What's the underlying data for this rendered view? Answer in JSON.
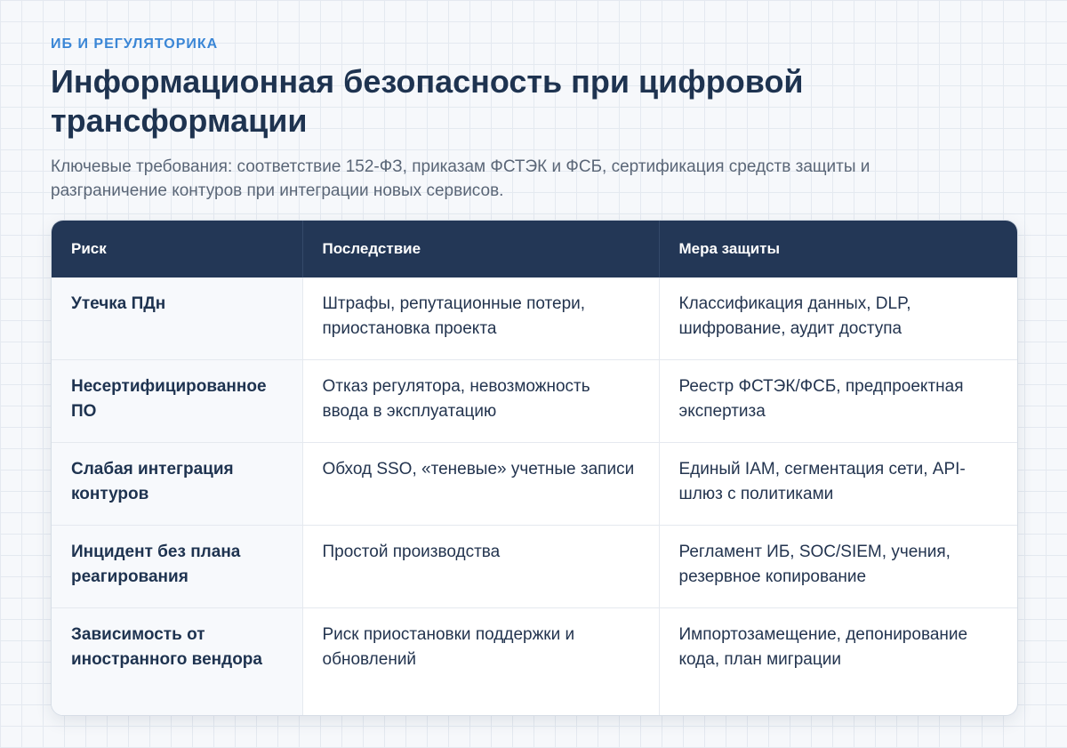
{
  "header": {
    "eyebrow": "ИБ И РЕГУЛЯТОРИКА",
    "title": "Информационная безопасность при цифровой трансформации",
    "subtitle": "Ключевые требования: соответствие 152-ФЗ, приказам ФСТЭК и ФСБ, сертификация средств защиты и разграничение контуров при интеграции новых сервисов."
  },
  "table": {
    "columns": [
      "Риск",
      "Последствие",
      "Мера защиты"
    ],
    "rows": [
      {
        "risk": "Утечка ПДн",
        "consequence": "Штрафы, репутационные потери, приостановка проекта",
        "measure": "Классификация данных, DLP, шифрование, аудит доступа"
      },
      {
        "risk": "Несертифицированное ПО",
        "consequence": "Отказ регулятора, невозможность ввода в эксплуатацию",
        "measure": "Реестр ФСТЭК/ФСБ, предпроектная экспертиза"
      },
      {
        "risk": "Слабая интеграция контуров",
        "consequence": "Обход SSO, «теневые» учетные записи",
        "measure": "Единый IAM, сегментация сети, API-шлюз с политиками"
      },
      {
        "risk": "Инцидент без плана реагирования",
        "consequence": "Простой производства",
        "measure": "Регламент ИБ, SOC/SIEM, учения, резервное копирование"
      },
      {
        "risk": "Зависимость от иностранного вендора",
        "consequence": "Риск приостановки поддержки и обновлений",
        "measure": "Импортозамещение, депонирование кода, план миграции"
      }
    ]
  }
}
